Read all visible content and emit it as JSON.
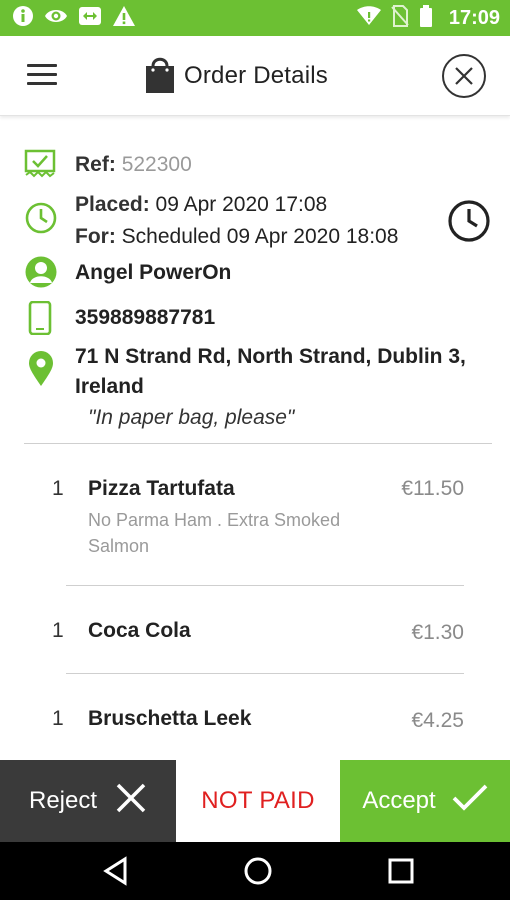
{
  "status_bar": {
    "time": "17:09",
    "icons": [
      "info-icon",
      "eye-icon",
      "cast-icon",
      "warning-icon",
      "wifi-icon",
      "no-sim-icon",
      "battery-icon"
    ]
  },
  "header": {
    "title": "Order Details",
    "icons": {
      "menu": "hamburger-menu-icon",
      "bag": "shopping-bag-icon",
      "close": "close-circle-icon"
    }
  },
  "order": {
    "ref_label": "Ref:",
    "ref_value": "522300",
    "placed_label": "Placed:",
    "placed_value": "09 Apr 2020 17:08",
    "for_label": "For:",
    "for_value": "Scheduled 09 Apr 2020 18:08",
    "customer_name": "Angel PowerOn",
    "phone": "359889887781",
    "address_line1": "71 N Strand Rd, North Strand, Dublin 3,",
    "address_line2": "Ireland",
    "delivery_note": "\"In paper bag, please\""
  },
  "items": [
    {
      "qty": "1",
      "name": "Pizza Tartufata",
      "price": "€11.50",
      "mods_line1": "No Parma Ham . Extra Smoked",
      "mods_line2": "Salmon"
    },
    {
      "qty": "1",
      "name": "Coca Cola",
      "price": "€1.30"
    },
    {
      "qty": "1",
      "name": "Bruschetta Leek",
      "price": "€4.25"
    }
  ],
  "actions": {
    "reject_label": "Reject",
    "payment_status": "NOT PAID",
    "accept_label": "Accept"
  },
  "colors": {
    "brand_green": "#6cc033",
    "reject_bg": "#3a3a3a",
    "not_paid_red": "#e02020"
  },
  "nav": {
    "icons": [
      "back-icon",
      "home-icon",
      "recents-icon"
    ]
  }
}
